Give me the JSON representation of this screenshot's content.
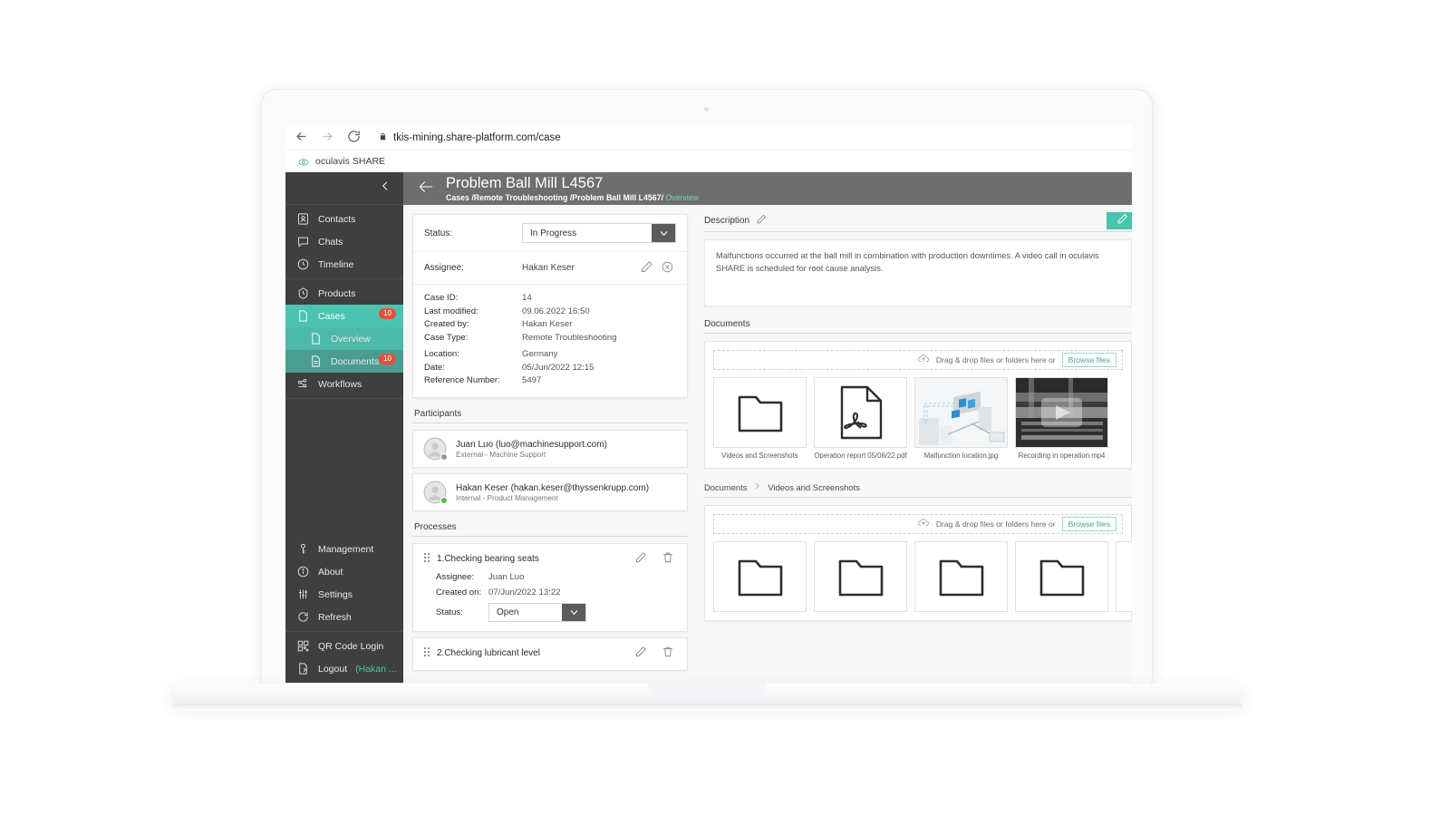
{
  "browser": {
    "back_icon": "arrow-left-icon",
    "forward_icon": "arrow-right-icon",
    "reload_icon": "reload-icon",
    "lock_icon": "lock-icon",
    "url": "tkis-mining.share-platform.com/case",
    "bookmark_label": "oculavis SHARE"
  },
  "sidebar": {
    "collapse_icon": "chevron-left-icon",
    "groups": [
      {
        "items": [
          {
            "label": "Contacts",
            "icon": "contact-card-icon"
          },
          {
            "label": "Chats",
            "icon": "chat-bubble-icon"
          },
          {
            "label": "Timeline",
            "icon": "clock-icon"
          }
        ]
      },
      {
        "items": [
          {
            "label": "Products",
            "icon": "product-shield-icon"
          },
          {
            "label": "Cases",
            "icon": "case-file-icon",
            "badge": "10",
            "state": "active"
          },
          {
            "label": "Overview",
            "icon": "overview-file-icon",
            "state": "sub"
          },
          {
            "label": "Documents",
            "icon": "documents-icon",
            "badge": "10",
            "state": "sub2"
          },
          {
            "label": "Workflows",
            "icon": "workflows-icon"
          }
        ]
      },
      {
        "items": [
          {
            "label": "Management",
            "icon": "key-icon"
          },
          {
            "label": "About",
            "icon": "info-icon"
          },
          {
            "label": "Settings",
            "icon": "sliders-icon"
          },
          {
            "label": "Refresh",
            "icon": "refresh-icon"
          }
        ]
      },
      {
        "items": [
          {
            "label": "QR Code Login",
            "icon": "qr-code-icon"
          },
          {
            "label": "Logout",
            "suffix": "(Hakan ...",
            "icon": "logout-icon"
          }
        ]
      }
    ]
  },
  "header": {
    "back_icon": "arrow-left-icon",
    "title": "Problem Ball Mill L4567",
    "breadcrumb": "Cases /Remote Troubleshooting /Problem Ball Mill L4567/ ",
    "breadcrumb_current": "Overview"
  },
  "case_card": {
    "status_label": "Status:",
    "status_value": "In Progress",
    "status_caret_icon": "chevron-down-icon",
    "assignee_label": "Assignee:",
    "assignee_value": "Hakan Keser",
    "assignee_edit_icon": "pencil-icon",
    "assignee_remove_icon": "remove-circle-icon",
    "details": [
      {
        "key": "Case ID:",
        "value": "14"
      },
      {
        "key": "Last modified:",
        "value": "09.06.2022  16:50"
      },
      {
        "key": "Created by:",
        "value": "Hakan Keser"
      },
      {
        "key": "Case Type:",
        "value": "Remote Troubleshooting"
      },
      {
        "key": "Location:",
        "value": "Germany"
      },
      {
        "key": "Date:",
        "value": "05/Jun/2022 12:15"
      },
      {
        "key": "Reference Number:",
        "value": "5497"
      }
    ]
  },
  "participants": {
    "section_label": "Participants",
    "items": [
      {
        "name": "Juan Luo (luo@machinesupport.com)",
        "role": "External - Machine Support",
        "presence_color": "#9a9a9a",
        "avatar_icon": "user-avatar-icon"
      },
      {
        "name": "Hakan Keser (hakan.keser@thyssenkrupp.com)",
        "role": "Internal - Product Management",
        "presence_color": "#54c24a",
        "avatar_icon": "user-avatar-icon"
      }
    ]
  },
  "processes": {
    "section_label": "Processes",
    "items": [
      {
        "title": "1.Checking bearing seats",
        "grip_icon": "drag-handle-icon",
        "edit_icon": "pencil-icon",
        "delete_icon": "trash-icon",
        "assignee_label": "Assignee:",
        "assignee_value": "Juan Luo",
        "created_label": "Created on:",
        "created_value": "07/Jun/2022 13:22",
        "status_label": "Status:",
        "status_value": "Open",
        "status_caret_icon": "chevron-down-icon"
      },
      {
        "title": "2.Checking lubricant level",
        "grip_icon": "drag-handle-icon",
        "edit_icon": "pencil-icon",
        "delete_icon": "trash-icon"
      }
    ]
  },
  "description": {
    "label": "Description",
    "edit_icon": "pencil-icon",
    "text": "Malfunctions occurred at the ball mill in combination with production downtimes. A video call in oculavis SHARE is scheduled for root cause analysis."
  },
  "documents": {
    "label": "Documents",
    "dropzone": {
      "upload_icon": "cloud-upload-icon",
      "text": "Drag & drop files or folders here  or",
      "browse_label": "Browse files"
    },
    "files": [
      {
        "name": "Videos and Screenshots",
        "kind": "folder"
      },
      {
        "name": "Operation report 05/06/22.pdf",
        "kind": "pdf"
      },
      {
        "name": "Malfunction location.jpg",
        "kind": "image"
      },
      {
        "name": "Recording in operation.mp4",
        "kind": "video"
      }
    ]
  },
  "documents_sub": {
    "breadcrumb_root": "Documents",
    "breadcrumb_sep_icon": "chevron-right-icon",
    "breadcrumb_current": "Videos and Screenshots",
    "dropzone": {
      "upload_icon": "cloud-upload-icon",
      "text": "Drag & drop files or folders here  or",
      "browse_label": "Browse files"
    },
    "files": [
      {
        "name": "",
        "kind": "folder"
      },
      {
        "name": "",
        "kind": "folder"
      },
      {
        "name": "",
        "kind": "folder"
      },
      {
        "name": "",
        "kind": "folder"
      },
      {
        "name": "",
        "kind": "folder"
      }
    ]
  },
  "edit_fab": {
    "icon": "pencil-icon"
  },
  "colors": {
    "accent_teal": "#4ac4b0",
    "badge_red": "#e8503a",
    "sidebar_dark": "#3f3f3f",
    "header_gray": "#6e6e6e"
  }
}
